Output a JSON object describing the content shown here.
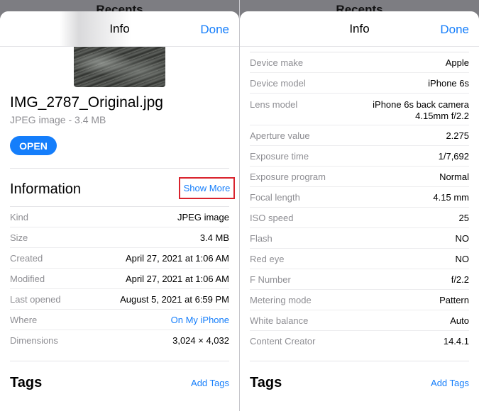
{
  "behind_title": "Recents",
  "left": {
    "nav_title": "Info",
    "done": "Done",
    "file": {
      "name": "IMG_2787_Original.jpg",
      "type_size": "JPEG image - 3.4 MB",
      "open_label": "OPEN"
    },
    "information": {
      "title": "Information",
      "show_more": "Show More",
      "rows": [
        {
          "label": "Kind",
          "value": "JPEG image"
        },
        {
          "label": "Size",
          "value": "3.4 MB"
        },
        {
          "label": "Created",
          "value": "April 27, 2021 at 1:06 AM"
        },
        {
          "label": "Modified",
          "value": "April 27, 2021 at 1:06 AM"
        },
        {
          "label": "Last opened",
          "value": "August 5, 2021 at 6:59 PM"
        },
        {
          "label": "Where",
          "value": "On My iPhone"
        },
        {
          "label": "Dimensions",
          "value": "3,024 × 4,032"
        }
      ]
    },
    "tags": {
      "title": "Tags",
      "add": "Add Tags"
    }
  },
  "right": {
    "nav_title": "Info",
    "done": "Done",
    "rows": [
      {
        "label": "Device make",
        "value": "Apple"
      },
      {
        "label": "Device model",
        "value": "iPhone 6s"
      },
      {
        "label": "Lens model",
        "value": "iPhone 6s back camera 4.15mm f/2.2"
      },
      {
        "label": "Aperture value",
        "value": "2.275"
      },
      {
        "label": "Exposure time",
        "value": "1/7,692"
      },
      {
        "label": "Exposure program",
        "value": "Normal"
      },
      {
        "label": "Focal length",
        "value": "4.15 mm"
      },
      {
        "label": "ISO speed",
        "value": "25"
      },
      {
        "label": "Flash",
        "value": "NO"
      },
      {
        "label": "Red eye",
        "value": "NO"
      },
      {
        "label": "F Number",
        "value": "f/2.2"
      },
      {
        "label": "Metering mode",
        "value": "Pattern"
      },
      {
        "label": "White balance",
        "value": "Auto"
      },
      {
        "label": "Content Creator",
        "value": "14.4.1"
      }
    ],
    "tags": {
      "title": "Tags",
      "add": "Add Tags"
    }
  },
  "colors": {
    "accent": "#157efb",
    "highlight_box": "#d9232d",
    "secondary_text": "#8e8e93"
  }
}
